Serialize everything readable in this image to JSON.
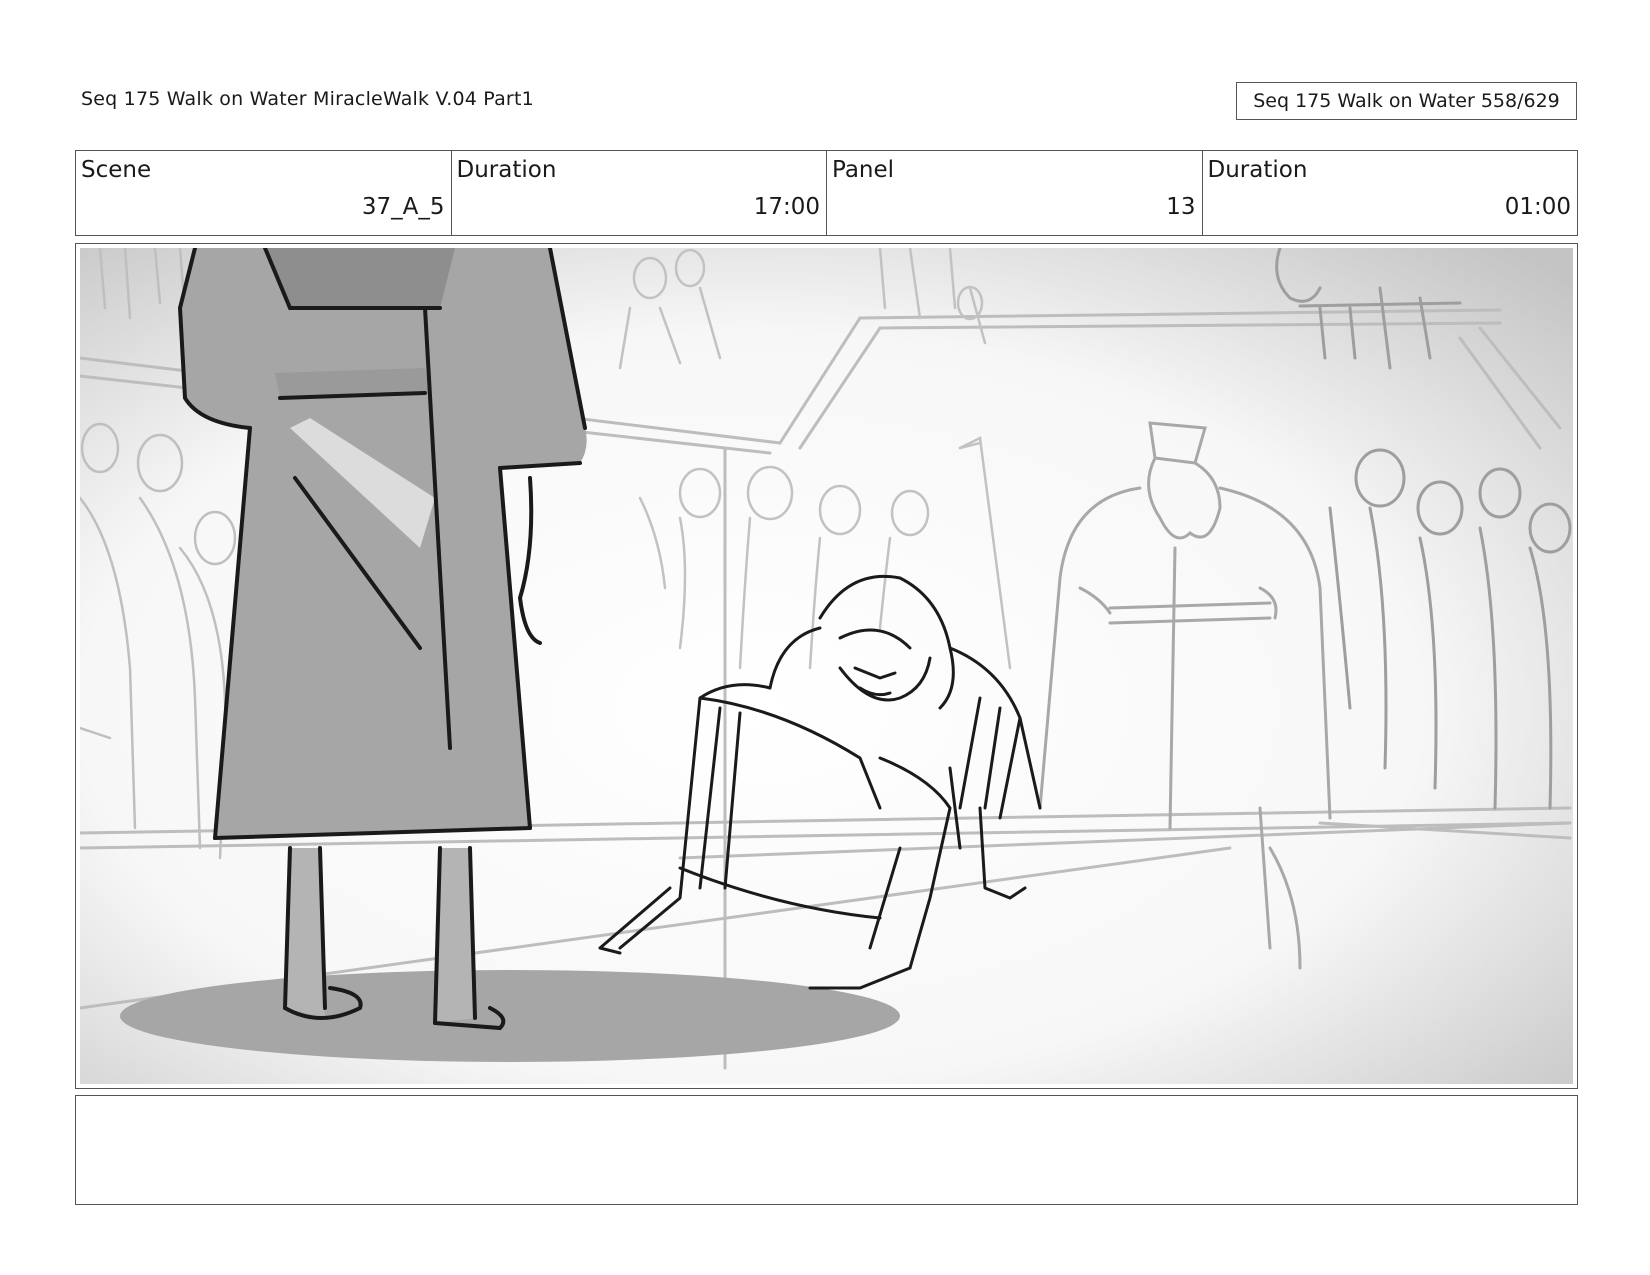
{
  "header": {
    "title": "Seq 175 Walk on Water  MiracleWalk V.04 Part1",
    "page_counter": "Seq 175 Walk on Water 558/629"
  },
  "info": {
    "scene_label": "Scene",
    "scene_value": "37_A_5",
    "duration_label": "Duration",
    "duration_value": "17:00",
    "panel_label": "Panel",
    "panel_value": "13",
    "panel_duration_label": "Duration",
    "panel_duration_value": "01:00"
  },
  "notes": {
    "text": ""
  },
  "colors": {
    "border": "#555555",
    "robe": "#a6a6a6",
    "sketch_light": "#b8b8b8",
    "sketch_dark": "#1a1a1a"
  }
}
